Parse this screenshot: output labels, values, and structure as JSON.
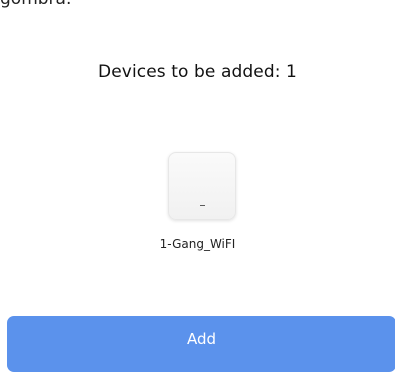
{
  "top_text": "gombra.",
  "title": "Devices to be added: 1",
  "devices": [
    {
      "name": "1-Gang_WiFI"
    }
  ],
  "add_button_label": "Add",
  "colors": {
    "button_bg": "#5b92ec",
    "button_text": "#ffffff",
    "background": "#ffffff"
  }
}
